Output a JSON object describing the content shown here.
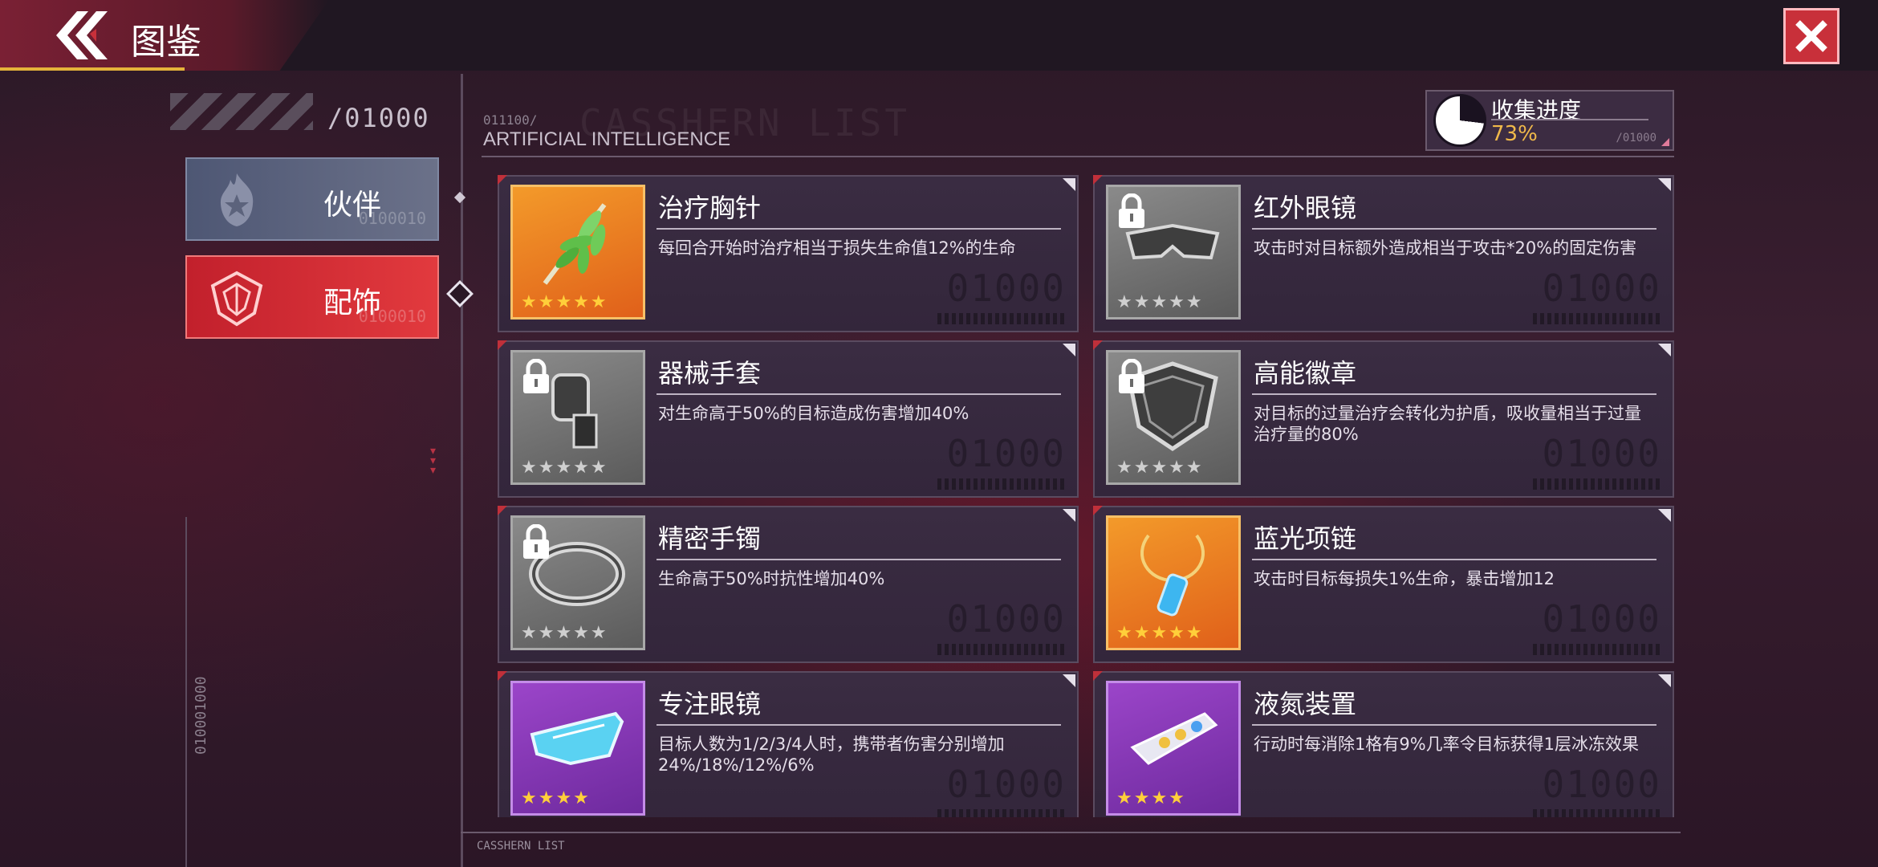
{
  "header": {
    "title": "图鉴"
  },
  "sidebar": {
    "count": "/01000",
    "tabs": [
      {
        "label": "伙伴",
        "sub": "0100010",
        "icon": "flame-star-icon"
      },
      {
        "label": "配饰",
        "sub": "0100010",
        "icon": "shield-emblem-icon"
      }
    ],
    "vertical_code": "010001000"
  },
  "list_header": {
    "code": "011100/",
    "watermark": "CASSHERN LIST",
    "subtitle": "ARTIFICIAL INTELLIGENCE"
  },
  "collection": {
    "label": "收集进度",
    "value": "73%",
    "progress": 0.73,
    "sub": "/01000"
  },
  "cards": [
    {
      "name": "治疗胸针",
      "desc": "每回合开始时治疗相当于损失生命值12%的生命",
      "rarity": "orange",
      "stars": 5,
      "locked": false,
      "icon": "leaf-brooch-icon",
      "bg": "01000"
    },
    {
      "name": "红外眼镜",
      "desc": "攻击时对目标额外造成相当于攻击*20%的固定伤害",
      "rarity": "grey",
      "stars": 5,
      "locked": true,
      "icon": "infrared-goggles-icon",
      "bg": "01000"
    },
    {
      "name": "器械手套",
      "desc": "对生命高于50%的目标造成伤害增加40%",
      "rarity": "grey",
      "stars": 5,
      "locked": true,
      "icon": "mech-glove-icon",
      "bg": "01000"
    },
    {
      "name": "高能徽章",
      "desc": "对目标的过量治疗会转化为护盾，吸收量相当于过量治疗量的80%",
      "rarity": "grey",
      "stars": 5,
      "locked": true,
      "icon": "energy-badge-icon",
      "bg": "01000"
    },
    {
      "name": "精密手镯",
      "desc": "生命高于50%时抗性增加40%",
      "rarity": "grey",
      "stars": 5,
      "locked": true,
      "icon": "precision-bracelet-icon",
      "bg": "01000"
    },
    {
      "name": "蓝光项链",
      "desc": "攻击时目标每损失1%生命，暴击增加12",
      "rarity": "orange",
      "stars": 5,
      "locked": false,
      "icon": "blue-crystal-necklace-icon",
      "bg": "01000"
    },
    {
      "name": "专注眼镜",
      "desc": "目标人数为1/2/3/4人时，携带者伤害分别增加24%/18%/12%/6%",
      "rarity": "purple",
      "stars": 4,
      "locked": false,
      "icon": "visor-glasses-icon",
      "bg": "01000"
    },
    {
      "name": "液氮装置",
      "desc": "行动时每消除1格有9%几率令目标获得1层冰冻效果",
      "rarity": "purple",
      "stars": 4,
      "locked": false,
      "icon": "liquid-nitrogen-device-icon",
      "bg": "01000"
    }
  ],
  "footer": {
    "label": "CASSHERN LIST"
  },
  "colors": {
    "accent_red": "#c8303a",
    "gold": "#f0b94a",
    "orange_rarity": "#f39a2a",
    "purple_rarity": "#9b45c9",
    "grey_rarity": "#7a7a7a"
  }
}
